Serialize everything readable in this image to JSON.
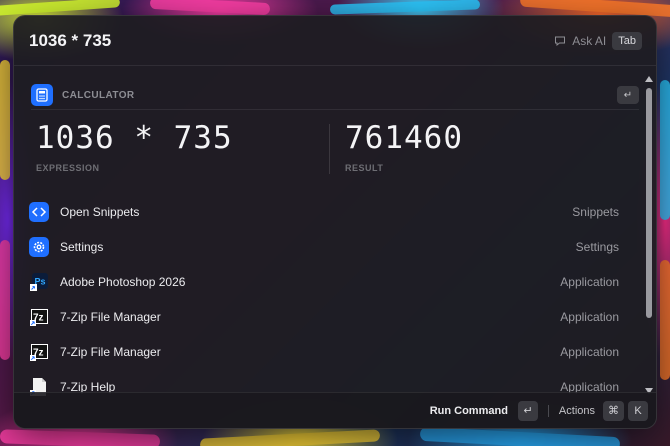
{
  "search": {
    "query": "1036 * 735",
    "ask_ai_label": "Ask AI",
    "tab_key": "Tab"
  },
  "calculator": {
    "section_title": "CALCULATOR",
    "enter_key": "↵",
    "expression": "1036 * 735",
    "expression_caption": "EXPRESSION",
    "result": "761460",
    "result_caption": "RESULT"
  },
  "results": [
    {
      "title": "Open Snippets",
      "kind": "Snippets",
      "icon": "code-icon"
    },
    {
      "title": "Settings",
      "kind": "Settings",
      "icon": "gear-icon"
    },
    {
      "title": "Adobe Photoshop 2026",
      "kind": "Application",
      "icon": "photoshop-icon"
    },
    {
      "title": "7-Zip File Manager",
      "kind": "Application",
      "icon": "7zip-icon"
    },
    {
      "title": "7-Zip File Manager",
      "kind": "Application",
      "icon": "7zip-icon"
    },
    {
      "title": "7-Zip Help",
      "kind": "Application",
      "icon": "help-document-icon"
    }
  ],
  "footer": {
    "primary_action": "Run Command",
    "primary_key": "↵",
    "actions_label": "Actions",
    "actions_key_mod": "⌘",
    "actions_key": "K"
  },
  "colors": {
    "accent_blue": "#1f6fff",
    "panel_bg": "#1e1c22"
  }
}
